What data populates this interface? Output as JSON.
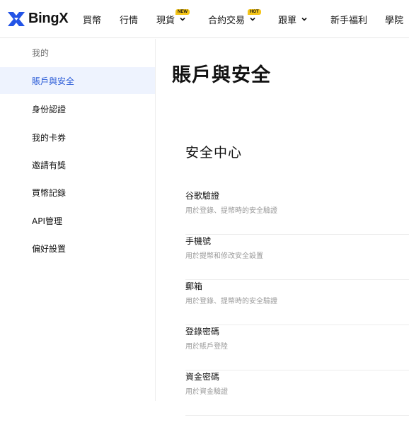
{
  "brand": {
    "name": "BingX",
    "color": "#2354e6"
  },
  "nav": {
    "items": [
      {
        "label": "買幣"
      },
      {
        "label": "行情"
      },
      {
        "label": "現貨",
        "badge": "NEW",
        "has_dropdown": true
      },
      {
        "label": "合約交易",
        "badge": "HOT",
        "has_dropdown": true
      },
      {
        "label": "跟單",
        "has_dropdown": true
      },
      {
        "label": "新手福利"
      },
      {
        "label": "學院"
      }
    ]
  },
  "sidebar": {
    "items": [
      {
        "label": "我的",
        "state": "muted"
      },
      {
        "label": "賬戶與安全",
        "state": "active"
      },
      {
        "label": "身份認證"
      },
      {
        "label": "我的卡券"
      },
      {
        "label": "邀請有獎"
      },
      {
        "label": "買幣記錄"
      },
      {
        "label": "API管理"
      },
      {
        "label": "偏好設置"
      }
    ]
  },
  "main": {
    "title": "賬戶與安全",
    "section_title": "安全中心",
    "security_items": [
      {
        "title": "谷歌驗證",
        "desc": "用於登錄、提幣時的安全驗證"
      },
      {
        "title": "手機號",
        "desc": "用於提幣和修改安全設置"
      },
      {
        "title": "郵箱",
        "desc": "用於登錄、提幣時的安全驗證"
      },
      {
        "title": "登錄密碼",
        "desc": "用於賬戶登陸"
      },
      {
        "title": "資金密碼",
        "desc": "用於資金驗證"
      }
    ]
  },
  "colors": {
    "accent": "#2a5bd7",
    "active_bg": "#eef3fe",
    "badge_bg": "#f5c518"
  }
}
